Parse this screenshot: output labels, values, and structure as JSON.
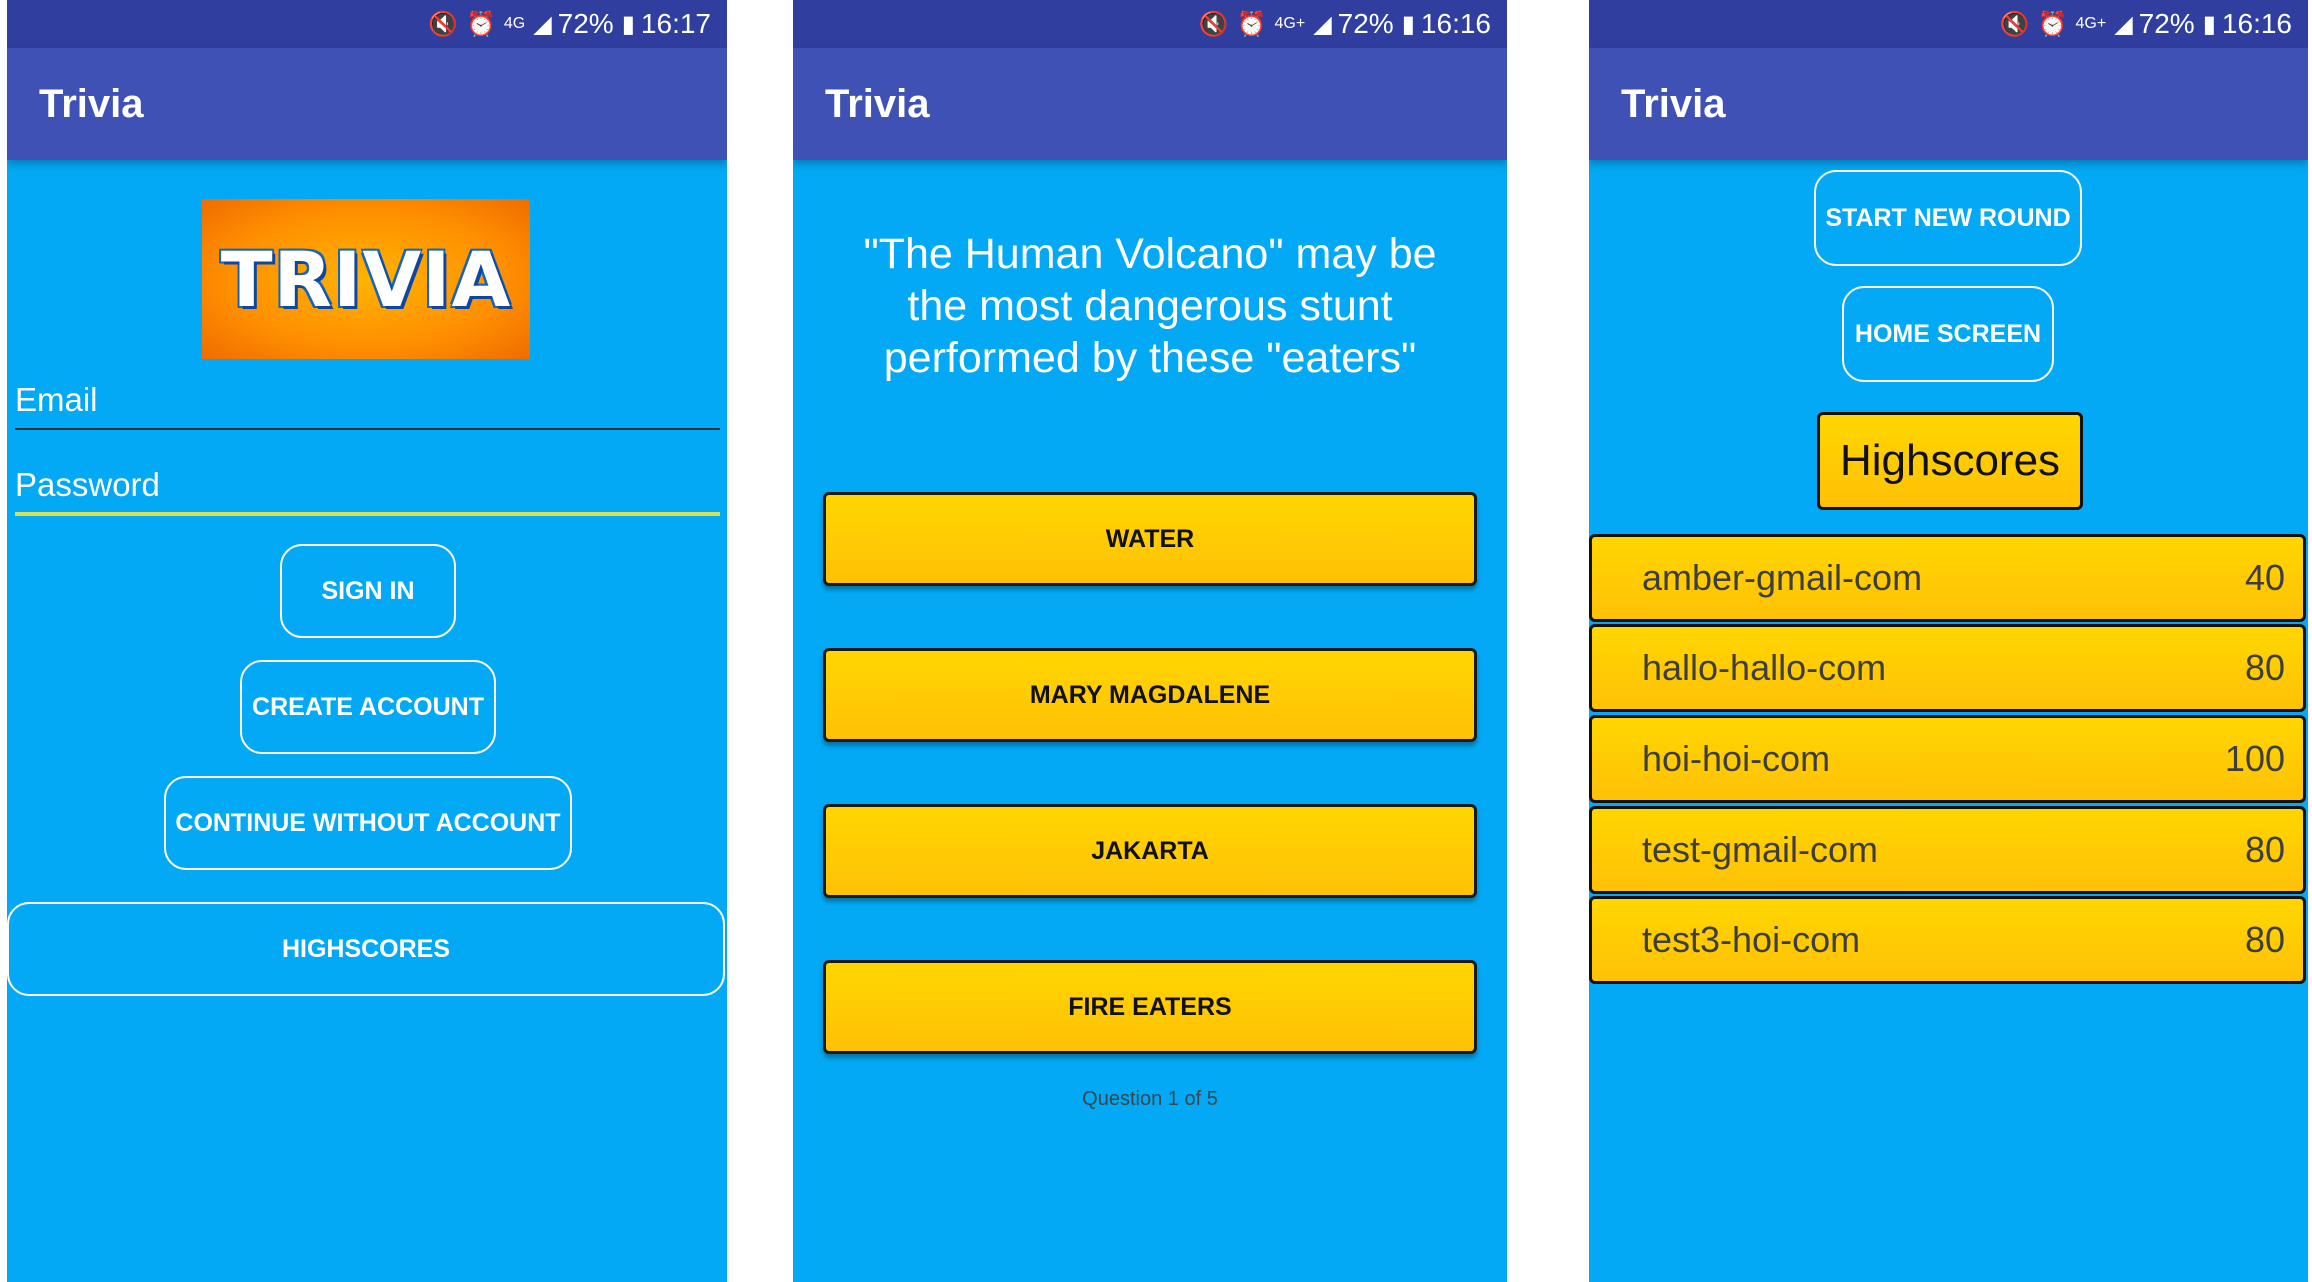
{
  "status": {
    "phone1": {
      "battery": "72%",
      "time": "16:17",
      "network": "4G"
    },
    "phone2": {
      "battery": "72%",
      "time": "16:16",
      "network": "4G+"
    },
    "phone3": {
      "battery": "72%",
      "time": "16:16",
      "network": "4G+"
    }
  },
  "app_title": "Trivia",
  "login": {
    "logo_text": "TRIVIA",
    "email_placeholder": "Email",
    "password_placeholder": "Password",
    "sign_in": "SIGN IN",
    "create_account": "CREATE ACCOUNT",
    "continue_without": "CONTINUE WITHOUT ACCOUNT",
    "highscores": "HIGHSCORES"
  },
  "quiz": {
    "question": "\"The Human Volcano\" may be the most dangerous stunt performed by these \"eaters\"",
    "answers": [
      "WATER",
      "MARY MAGDALENE",
      "JAKARTA",
      "FIRE EATERS"
    ],
    "progress": "Question 1 of 5"
  },
  "scores": {
    "start_new_round": "START NEW ROUND",
    "home_screen": "HOME SCREEN",
    "heading": "Highscores",
    "rows": [
      {
        "name": "amber-gmail-com",
        "score": "40"
      },
      {
        "name": "hallo-hallo-com",
        "score": "80"
      },
      {
        "name": "hoi-hoi-com",
        "score": "100"
      },
      {
        "name": "test-gmail-com",
        "score": "80"
      },
      {
        "name": "test3-hoi-com",
        "score": "80"
      }
    ]
  },
  "icons": [
    "mute-icon",
    "alarm-icon",
    "signal-icon",
    "battery-icon"
  ],
  "colors": {
    "background": "#03a9f4",
    "app_bar": "#3f51b5",
    "status_bar": "#303f9f",
    "button_yellow": "#ffc107",
    "password_underline": "#d4e157"
  }
}
